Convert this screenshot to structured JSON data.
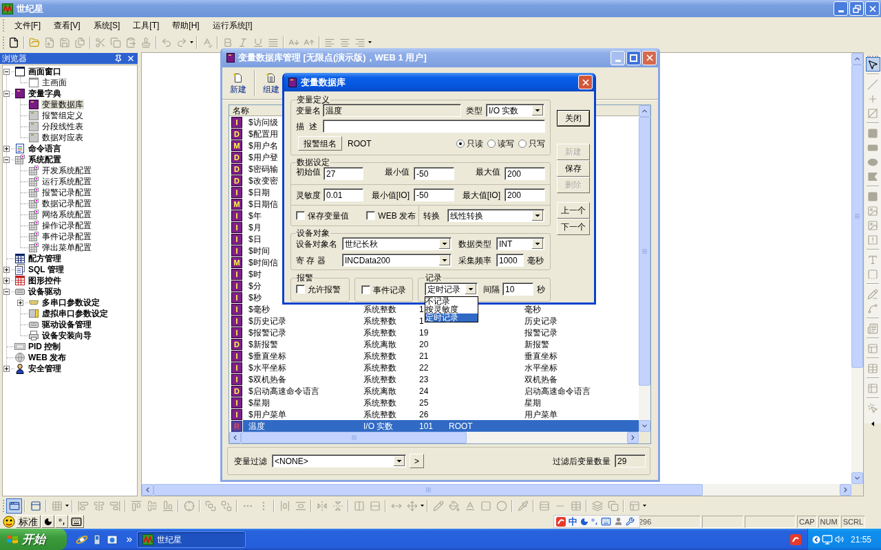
{
  "window": {
    "title": "世纪星"
  },
  "menu": [
    "文件[F]",
    "查看[V]",
    "系统[S]",
    "工具[T]",
    "帮助[H]",
    "运行系统[!]"
  ],
  "toolbar": [
    {
      "disabled": false
    },
    {
      "disabled": false
    },
    {
      "disabled": true
    },
    {
      "disabled": true
    },
    {
      "disabled": true
    },
    {
      "disabled": true
    },
    {
      "disabled": true
    },
    {
      "disabled": true
    },
    {
      "disabled": true
    },
    {
      "disabled": true
    },
    {
      "disabled": true
    },
    {
      "disabled": true
    },
    {
      "disabled": true
    },
    {
      "disabled": true
    },
    {
      "disabled": true
    },
    {
      "disabled": true
    },
    {
      "disabled": true
    },
    {
      "disabled": true
    },
    {
      "disabled": true
    },
    {
      "disabled": true
    },
    {
      "disabled": true
    }
  ],
  "browser": {
    "title": "浏览器",
    "tree": [
      {
        "label": "画面窗口",
        "bold": true,
        "selected": false,
        "expanded": true,
        "children": [
          {
            "label": "主画面",
            "bold": false,
            "selected": false
          }
        ]
      },
      {
        "label": "变量字典",
        "bold": true,
        "selected": false,
        "expanded": true,
        "children": [
          {
            "label": "变量数据库",
            "bold": false,
            "selected": true
          },
          {
            "label": "报警组定义",
            "bold": false,
            "selected": false
          },
          {
            "label": "分段线性表",
            "bold": false,
            "selected": false
          },
          {
            "label": "数据对应表",
            "bold": false,
            "selected": false
          }
        ]
      },
      {
        "label": "命令语言",
        "bold": true,
        "selected": false,
        "expanded": false
      },
      {
        "label": "系统配置",
        "bold": true,
        "selected": false,
        "expanded": true,
        "children": [
          {
            "label": "开发系统配置",
            "bold": false,
            "selected": false
          },
          {
            "label": "运行系统配置",
            "bold": false,
            "selected": false
          },
          {
            "label": "报警记录配置",
            "bold": false,
            "selected": false
          },
          {
            "label": "数据记录配置",
            "bold": false,
            "selected": false
          },
          {
            "label": "网络系统配置",
            "bold": false,
            "selected": false
          },
          {
            "label": "操作记录配置",
            "bold": false,
            "selected": false
          },
          {
            "label": "事件记录配置",
            "bold": false,
            "selected": false
          },
          {
            "label": "弹出菜单配置",
            "bold": false,
            "selected": false
          }
        ]
      },
      {
        "label": "配方管理",
        "bold": true,
        "selected": false
      },
      {
        "label": "SQL 管理",
        "bold": true,
        "selected": false,
        "expanded": false
      },
      {
        "label": "图形控件",
        "bold": true,
        "selected": false,
        "expanded": false
      },
      {
        "label": "设备驱动",
        "bold": true,
        "selected": false,
        "expanded": true,
        "children": [
          {
            "label": "多串口参数设定",
            "bold": true,
            "selected": false,
            "expanded": false
          },
          {
            "label": "虚拟串口参数设定",
            "bold": true,
            "selected": false
          },
          {
            "label": "驱动设备管理",
            "bold": true,
            "selected": false
          },
          {
            "label": "设备安装向导",
            "bold": true,
            "selected": false
          }
        ]
      },
      {
        "label": "PID 控制",
        "bold": true,
        "selected": false
      },
      {
        "label": "WEB 发布",
        "bold": true,
        "selected": false
      },
      {
        "label": "安全管理",
        "bold": true,
        "selected": false,
        "expanded": false
      }
    ]
  },
  "var_manager": {
    "title": "变量数据库管理 [无限点(演示版)，WEB 1 用户]",
    "toolbar": [
      {
        "label": "新建"
      },
      {
        "label": "组建"
      }
    ],
    "columns": [
      {
        "label": "名称"
      }
    ],
    "rows": [
      {
        "tag": "I",
        "name": "$访问级",
        "selected": false
      },
      {
        "tag": "D",
        "name": "$配置用",
        "selected": false
      },
      {
        "tag": "M",
        "name": "$用户名",
        "selected": false
      },
      {
        "tag": "D",
        "name": "$用户登",
        "selected": false
      },
      {
        "tag": "D",
        "name": "$密码输",
        "selected": false
      },
      {
        "tag": "D",
        "name": "$改变密",
        "selected": false
      },
      {
        "tag": "I",
        "name": "$日期",
        "selected": false
      },
      {
        "tag": "M",
        "name": "$日期信",
        "selected": false
      },
      {
        "tag": "I",
        "name": "$年",
        "selected": false
      },
      {
        "tag": "I",
        "name": "$月",
        "selected": false
      },
      {
        "tag": "I",
        "name": "$日",
        "selected": false
      },
      {
        "tag": "I",
        "name": "$时间",
        "selected": false
      },
      {
        "tag": "M",
        "name": "$时间信",
        "selected": false
      },
      {
        "tag": "I",
        "name": "$时",
        "selected": false
      },
      {
        "tag": "I",
        "name": "$分",
        "selected": false
      },
      {
        "tag": "I",
        "name": "$秒",
        "selected": false
      },
      {
        "tag": "I",
        "name": "$毫秒",
        "column_2": "系统整数",
        "column_3": "1",
        "column_5": "毫秒",
        "selected": false
      },
      {
        "tag": "I",
        "name": "$历史记录",
        "column_2": "系统整数",
        "column_3": "1",
        "column_5": "历史记录",
        "selected": false
      },
      {
        "tag": "I",
        "name": "$报警记录",
        "column_2": "系统整数",
        "column_3": "19",
        "column_5": "报警记录",
        "selected": false
      },
      {
        "tag": "D",
        "name": "$新报警",
        "column_2": "系统离散",
        "column_3": "20",
        "column_5": "新报警",
        "selected": false
      },
      {
        "tag": "I",
        "name": "$垂直坐标",
        "column_2": "系统整数",
        "column_3": "21",
        "column_5": "垂直坐标",
        "selected": false
      },
      {
        "tag": "I",
        "name": "$水平坐标",
        "column_2": "系统整数",
        "column_3": "22",
        "column_5": "水平坐标",
        "selected": false
      },
      {
        "tag": "I",
        "name": "$双机热备",
        "column_2": "系统整数",
        "column_3": "23",
        "column_5": "双机热备",
        "selected": false
      },
      {
        "tag": "D",
        "name": "$启动高速命令语言",
        "column_2": "系统离散",
        "column_3": "24",
        "column_5": "启动高速命令语言",
        "selected": false
      },
      {
        "tag": "I",
        "name": "$星期",
        "column_2": "系统整数",
        "column_3": "25",
        "column_5": "星期",
        "selected": false
      },
      {
        "tag": "I",
        "name": "$用户菜单",
        "column_2": "系统整数",
        "column_3": "26",
        "column_5": "用户菜单",
        "selected": false
      },
      {
        "tag": "R",
        "name": "温度",
        "column_2": "I/O 实数",
        "column_3": "101",
        "column_4": "ROOT",
        "selected": true
      }
    ],
    "filter": {
      "label": "变量过滤",
      "value": "<NONE>",
      "button": ">",
      "count_label": "过滤后变量数量",
      "count": "29"
    }
  },
  "dialog": {
    "title": "变量数据库",
    "definition": {
      "title": "变量定义",
      "name_label": "变量名",
      "name": "温度",
      "type_label": "类型",
      "type": "I/O 实数",
      "desc_label": "描  述",
      "alarm_group_button": "报警组名",
      "alarm_group": "ROOT",
      "access": [
        {
          "label": "只读",
          "selected": true
        },
        {
          "label": "读写",
          "selected": false
        },
        {
          "label": "只写",
          "selected": false
        }
      ]
    },
    "data": {
      "title": "数据设定",
      "fields": [
        {
          "label": "初始值",
          "value": "27"
        },
        {
          "label": "最小值",
          "value": "-50"
        },
        {
          "label": "最大值",
          "value": "200"
        },
        {
          "label": "灵敏度",
          "value": "0.01"
        },
        {
          "label": "最小值[IO]",
          "value": "-50"
        },
        {
          "label": "最大值[IO]",
          "value": "200"
        }
      ],
      "options": [
        {
          "label": "保存变量值",
          "checked": false
        },
        {
          "label": "WEB 发布",
          "checked": false
        }
      ],
      "conversion_label": "转换",
      "conversion": "线性转换"
    },
    "device": {
      "title": "设备对象",
      "object_label": "设备对象名",
      "object": "世纪长秋",
      "data_type_label": "数据类型",
      "data_type": "INT",
      "register_label": "寄 存 器",
      "register": "INCData200",
      "rate_label": "采集频率",
      "rate": "1000",
      "rate_unit": "毫秒"
    },
    "alarm": {
      "title": "报警",
      "label": "允许报警",
      "checked": false
    },
    "event": {
      "label": "事件记录",
      "checked": false
    },
    "record": {
      "title": "记录",
      "mode": "定时记录",
      "expanded": true,
      "options": [
        {
          "label": "不记录",
          "selected": false
        },
        {
          "label": "按灵敏度",
          "selected": false
        },
        {
          "label": "定时记录",
          "selected": true
        }
      ],
      "interval_label": "间隔",
      "interval": "10",
      "unit": "秒"
    },
    "buttons": [
      [
        {
          "label": "关闭",
          "disabled": false,
          "default": true
        }
      ],
      [
        {
          "label": "新建",
          "disabled": true,
          "default": false
        },
        {
          "label": "保存",
          "disabled": false,
          "default": false
        },
        {
          "label": "删除",
          "disabled": true,
          "default": false
        }
      ],
      [
        {
          "label": "上一个",
          "disabled": false,
          "default": false
        },
        {
          "label": "下一个",
          "disabled": false,
          "default": false
        }
      ]
    ]
  },
  "bottom_toolbar": [
    {
      "selected": true,
      "disabled": false
    },
    {
      "selected": false,
      "disabled": false
    },
    {
      "selected": false,
      "disabled": true
    },
    {
      "selected": false,
      "disabled": true
    },
    {
      "selected": false,
      "disabled": true
    },
    {
      "selected": false,
      "disabled": true
    },
    {
      "selected": false,
      "disabled": true
    },
    {
      "selected": false,
      "disabled": true
    },
    {
      "selected": false,
      "disabled": true
    },
    {
      "selected": false,
      "disabled": true
    },
    {
      "selected": false,
      "disabled": true
    },
    {
      "selected": false,
      "disabled": true
    },
    {
      "selected": false,
      "disabled": true
    },
    {
      "selected": false,
      "disabled": true
    },
    {
      "selected": false,
      "disabled": true
    },
    {
      "selected": false,
      "disabled": true
    },
    {
      "selected": false,
      "disabled": true
    },
    {
      "selected": false,
      "disabled": true
    },
    {
      "selected": false,
      "disabled": true
    },
    {
      "selected": false,
      "disabled": true
    },
    {
      "selected": false,
      "disabled": true
    },
    {
      "selected": false,
      "disabled": true
    },
    {
      "selected": false,
      "disabled": true
    },
    {
      "selected": false,
      "disabled": true
    },
    {
      "selected": false,
      "disabled": true
    },
    {
      "selected": false,
      "disabled": true
    },
    {
      "selected": false,
      "disabled": true
    },
    {
      "selected": false,
      "disabled": true
    },
    {
      "selected": false,
      "disabled": true
    },
    {
      "selected": false,
      "disabled": true
    },
    {
      "selected": false,
      "disabled": true
    },
    {
      "selected": false,
      "disabled": true
    },
    {
      "selected": false,
      "disabled": true
    },
    {
      "selected": false,
      "disabled": true
    }
  ],
  "draw_toolbar": [
    {
      "selected": true,
      "disabled": false
    },
    {
      "selected": false,
      "disabled": true
    },
    {
      "selected": false,
      "disabled": true
    },
    {
      "selected": false,
      "disabled": true
    },
    {
      "selected": false,
      "disabled": true
    },
    {
      "selected": false,
      "disabled": true
    },
    {
      "selected": false,
      "disabled": true
    },
    {
      "selected": false,
      "disabled": true
    },
    {
      "selected": false,
      "disabled": true
    },
    {
      "selected": false,
      "disabled": true
    },
    {
      "selected": false,
      "disabled": true
    },
    {
      "selected": false,
      "disabled": true
    },
    {
      "selected": false,
      "disabled": true
    },
    {
      "selected": false,
      "disabled": true
    },
    {
      "selected": false,
      "disabled": true
    },
    {
      "selected": false,
      "disabled": true
    },
    {
      "selected": false,
      "disabled": true
    },
    {
      "selected": false,
      "disabled": true
    },
    {
      "selected": false,
      "disabled": true
    },
    {
      "selected": false,
      "disabled": true
    },
    {
      "selected": false,
      "disabled": true
    }
  ],
  "ime_bar": {
    "mode": "标准"
  },
  "status_bar": {
    "panels": [
      "296"
    ],
    "indicators": [
      "CAP",
      "NUM",
      "SCRL"
    ]
  },
  "sogou_bar": {
    "mode": "中"
  },
  "taskbar": {
    "start": "开始",
    "tasks": [
      {
        "label": "世纪星",
        "selected": true
      }
    ],
    "clock": "21:55"
  }
}
